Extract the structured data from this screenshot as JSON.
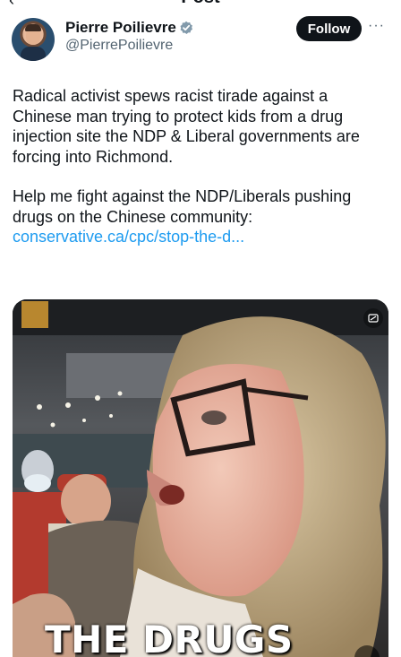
{
  "header": {
    "title": "Post",
    "back_icon": "back-arrow-icon"
  },
  "author": {
    "name": "Pierre Poilievre",
    "handle": "@PierrePoilievre",
    "verified_color": "#829aab",
    "avatar_icon": "profile-photo"
  },
  "actions": {
    "follow_label": "Follow",
    "more_label": "···"
  },
  "post": {
    "paragraph1": "Radical activist spews racist tirade against a Chinese man trying to protect kids from a drug injection site the NDP & Liberal governments are forcing into Richmond.",
    "paragraph2": "Help me fight against the NDP/Liberals pushing drugs on the Chinese community:",
    "link": "conservative.ca/cpc/stop-the-d..."
  },
  "media": {
    "caption": "THE DRUGS",
    "badge_icon": "gif-icon",
    "link_color": "#1d9bf0"
  }
}
